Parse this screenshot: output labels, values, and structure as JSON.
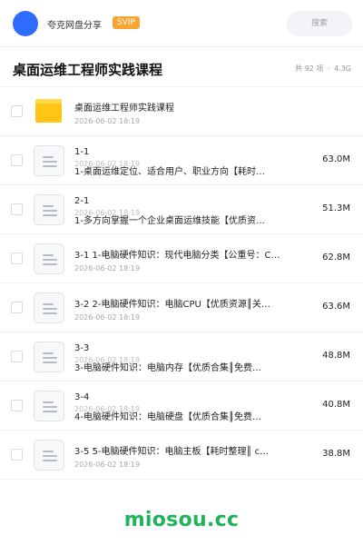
{
  "header": {
    "brand": "夸克网盘分享",
    "badge": "SVIP",
    "search_placeholder": "搜索"
  },
  "titlebar": {
    "title": "桌面运维工程师实践课程",
    "count": "共 92 项",
    "separator": "·",
    "size": "4.3G"
  },
  "items": [
    {
      "type": "folder",
      "name": "桌面运维工程师实践课程",
      "date": "2026-06-02 18:19",
      "size": ""
    },
    {
      "type": "file",
      "name_line1": "1-1",
      "name_line2": "1-桌面运维定位、适合用户、职业方向【耗时…",
      "date": "2026-06-02 18:19",
      "size": "63.0M"
    },
    {
      "type": "file",
      "name_line1": "2-1",
      "name_line2": "1-多方向掌握一个企业桌面运维技能【优质资…",
      "date": "2026-06-02 18:19",
      "size": "51.3M"
    },
    {
      "type": "file",
      "name": "3-1 1-电脑硬件知识：现代电脑分类【公重号：C…",
      "date": "2026-06-02 18:19",
      "size": "62.8M"
    },
    {
      "type": "file",
      "name": "3-2 2-电脑硬件知识：电脑CPU【优质资源║关…",
      "date": "2026-06-02 18:19",
      "size": "63.6M"
    },
    {
      "type": "file",
      "name_line1": "3-3",
      "name_line2": "3-电脑硬件知识：电脑内存【优质合集║免费…",
      "date": "2026-06-02 18:19",
      "size": "48.8M"
    },
    {
      "type": "file",
      "name_line1": "3-4",
      "name_line2": "4-电脑硬件知识：电脑硬盘【优质合集║免费…",
      "date": "2026-06-02 18:19",
      "size": "40.8M"
    },
    {
      "type": "file",
      "name": "3-5 5-电脑硬件知识：电脑主板【耗时整理║ c…",
      "date": "2026-06-02 18:19",
      "size": "38.8M"
    }
  ],
  "footer": {
    "watermark": "miosou.cc"
  }
}
